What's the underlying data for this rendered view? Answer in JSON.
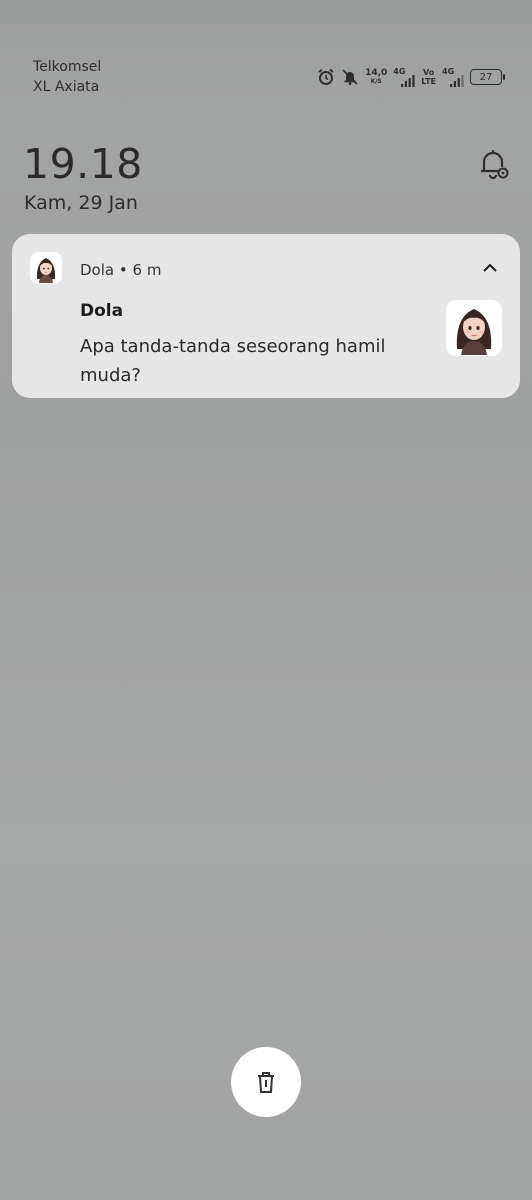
{
  "status_bar": {
    "carrier_1": "Telkomsel",
    "carrier_2": "XL Axiata",
    "net_speed_value": "14,0",
    "net_speed_unit": "K/S",
    "sim1_label": "4G",
    "volte_line1": "Vo",
    "volte_line2": "LTE",
    "sim2_label": "4G",
    "battery": "27",
    "icons": [
      "alarm-icon",
      "mute-icon",
      "signal-icon",
      "signal-icon",
      "battery-icon"
    ]
  },
  "lockscreen": {
    "time": "19.18",
    "date": "Kam, 29 Jan"
  },
  "notification": {
    "app_name": "Dola",
    "separator": "•",
    "age": "6 m",
    "title": "Dola",
    "body": "Apa tanda-tanda seseorang hamil muda?"
  },
  "colors": {
    "background": "#a2a3a3",
    "card": "#e6e6e6",
    "text": "#2b2b2b"
  }
}
